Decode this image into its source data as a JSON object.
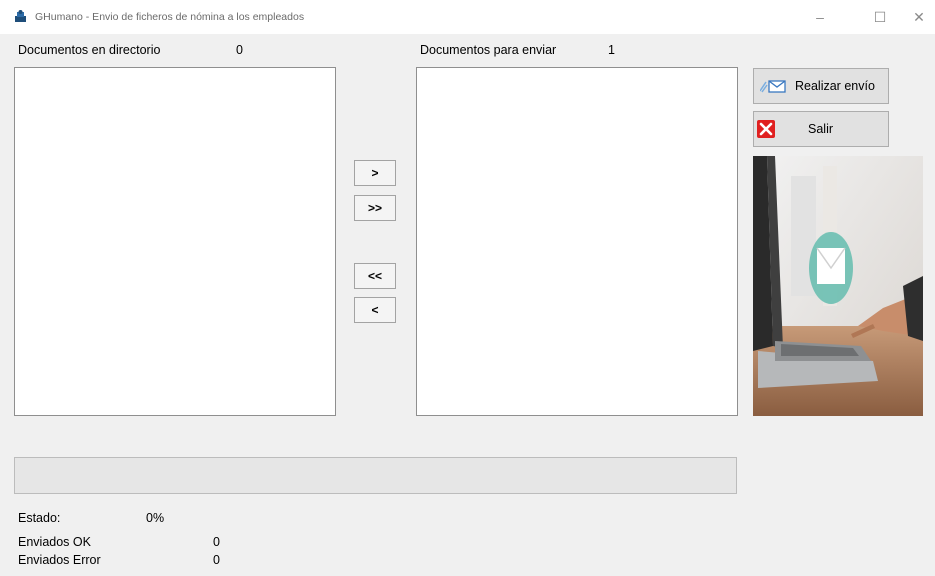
{
  "window": {
    "title": "GHumano - Envio de ficheros de nómina a los empleados",
    "minimize": "–",
    "maximize": "☐",
    "close": "✕"
  },
  "left_panel": {
    "label": "Documentos en directorio",
    "count": "0",
    "items": []
  },
  "right_panel": {
    "label": "Documentos para enviar",
    "count": "1",
    "items": []
  },
  "move_buttons": {
    "move_one_right": ">",
    "move_all_right": ">>",
    "move_all_left": "<<",
    "move_one_left": "<"
  },
  "actions": {
    "send_label": "Realizar envío",
    "send_icon": "envelope-icon",
    "exit_label": "Salir",
    "exit_icon": "red-x-icon"
  },
  "progress": {
    "value_percent": 0
  },
  "status": {
    "estado_label": "Estado:",
    "estado_value": "0%",
    "ok_label": "Enviados OK",
    "ok_value": "0",
    "error_label": "Enviados Error",
    "error_value": "0"
  },
  "colors": {
    "window_bg": "#f0f0f0",
    "exit_icon_red": "#e02020",
    "progress_green": "#06b025"
  }
}
